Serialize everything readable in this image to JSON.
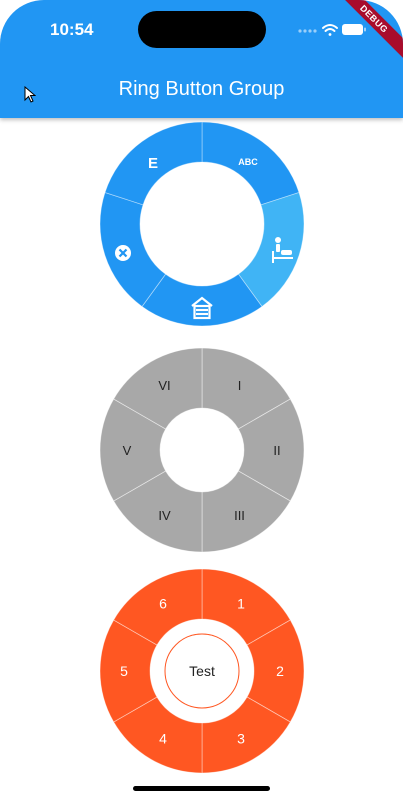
{
  "status_bar": {
    "time": "10:54"
  },
  "app_bar": {
    "title": "Ring Button Group"
  },
  "debug_label": "DEBUG",
  "ring1": {
    "color": "#2196F3",
    "selected_color": "#40B4F5",
    "icons": [
      "abc-icon",
      "baby-changing-icon",
      "house-icon",
      "cancel-icon",
      "e-letter-icon"
    ],
    "abc_text": "ABC",
    "e_text": "E"
  },
  "ring2": {
    "color": "#A8A8A8",
    "labels": [
      "I",
      "II",
      "III",
      "IV",
      "V",
      "VI"
    ]
  },
  "ring3": {
    "color": "#FF5722",
    "labels": [
      "1",
      "2",
      "3",
      "4",
      "5",
      "6"
    ],
    "center_label": "Test"
  }
}
